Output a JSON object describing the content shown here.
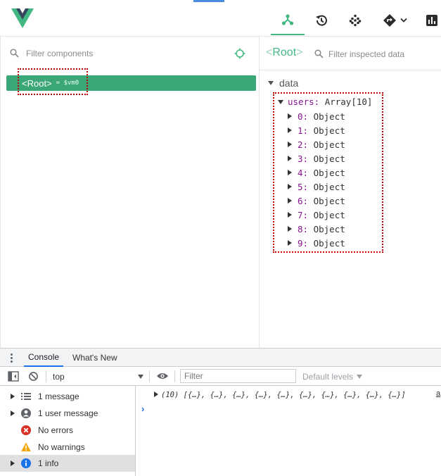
{
  "vue_devtools": {
    "nav": {
      "components": "components-tab",
      "timeline": "timeline-tab",
      "plugins": "plugins-tab",
      "routing": "routing-tab",
      "performance": "performance-tab"
    },
    "components_pane": {
      "filter_placeholder": "Filter components",
      "root_tag": "<Root>",
      "root_vm": "= $vm0"
    },
    "inspector": {
      "root_bracket_open": "<",
      "root_name": "Root",
      "root_bracket_close": ">",
      "filter_placeholder": "Filter inspected data",
      "section_label": "data",
      "users_key": "users:",
      "users_value": "Array[10]",
      "items": [
        {
          "key": "0:",
          "value": "Object"
        },
        {
          "key": "1:",
          "value": "Object"
        },
        {
          "key": "2:",
          "value": "Object"
        },
        {
          "key": "3:",
          "value": "Object"
        },
        {
          "key": "4:",
          "value": "Object"
        },
        {
          "key": "5:",
          "value": "Object"
        },
        {
          "key": "6:",
          "value": "Object"
        },
        {
          "key": "7:",
          "value": "Object"
        },
        {
          "key": "8:",
          "value": "Object"
        },
        {
          "key": "9:",
          "value": "Object"
        }
      ]
    },
    "accent_color": "#42b983"
  },
  "chrome_drawer": {
    "tabs": [
      "Console",
      "What's New"
    ],
    "toolbar": {
      "context": "top",
      "filter_placeholder": "Filter",
      "levels": "Default levels"
    },
    "sidebar": [
      {
        "label": "1 message",
        "icon": "list-icon"
      },
      {
        "label": "1 user message",
        "icon": "user-icon"
      },
      {
        "label": "No errors",
        "icon": "error-icon"
      },
      {
        "label": "No warnings",
        "icon": "warning-icon"
      },
      {
        "label": "1 info",
        "icon": "info-icon"
      }
    ],
    "log": {
      "text": "(10) [{…}, {…}, {…}, {…}, {…}, {…}, {…}, {…}, {…}, {…}]",
      "source": "a"
    },
    "prompt": "›"
  }
}
